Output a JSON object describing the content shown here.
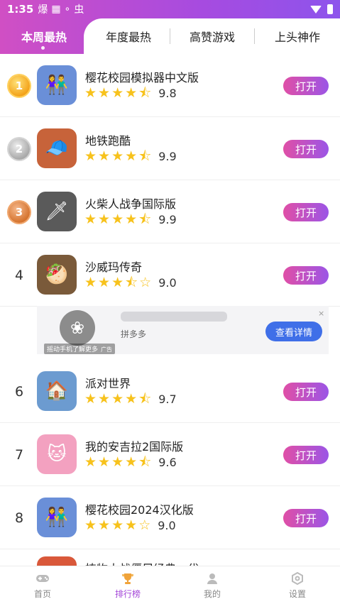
{
  "status_bar": {
    "time": "1:35",
    "icons": [
      "爆",
      "▦",
      "∘",
      "虫"
    ]
  },
  "tabs": {
    "active": "本周最热",
    "items": [
      "年度最热",
      "高赞游戏",
      "上头神作"
    ]
  },
  "apps": [
    {
      "rank": "1",
      "medal": "gold",
      "name": "樱花校园模拟器中文版",
      "rating": 4.5,
      "score": "9.8",
      "button": "打开",
      "icon_color": "#6a8fd8",
      "icon_glyph": "👫"
    },
    {
      "rank": "2",
      "medal": "silver",
      "name": "地铁跑酷",
      "rating": 4.5,
      "score": "9.9",
      "button": "打开",
      "icon_color": "#c7633a",
      "icon_glyph": "🧢"
    },
    {
      "rank": "3",
      "medal": "bronze",
      "name": "火柴人战争国际版",
      "rating": 4.5,
      "score": "9.9",
      "button": "打开",
      "icon_color": "#5a5a5a",
      "icon_glyph": "🗡"
    },
    {
      "rank": "4",
      "medal": "",
      "name": "沙威玛传奇",
      "rating": 3.5,
      "score": "9.0",
      "button": "打开",
      "icon_color": "#7a5a3a",
      "icon_glyph": "🥙"
    },
    {
      "rank": "6",
      "medal": "",
      "name": "派对世界",
      "rating": 4.5,
      "score": "9.7",
      "button": "打开",
      "icon_color": "#6c9bd0",
      "icon_glyph": "🏠"
    },
    {
      "rank": "7",
      "medal": "",
      "name": "我的安吉拉2国际版",
      "rating": 4.5,
      "score": "9.6",
      "button": "打开",
      "icon_color": "#f3a1c0",
      "icon_glyph": "🐱"
    },
    {
      "rank": "8",
      "medal": "",
      "name": "樱花校园2024汉化版",
      "rating": 4,
      "score": "9.0",
      "button": "打开",
      "icon_color": "#6a8fd8",
      "icon_glyph": "👫"
    }
  ],
  "ad": {
    "source": "拼多多",
    "button": "查看详情",
    "hint": "摇动手机了解更多",
    "tag": "广告",
    "close": "×"
  },
  "partial_row_name": "植物大战僵尸经典一代",
  "bottom_nav": [
    {
      "label": "首页",
      "icon": "gamepad-icon",
      "active": false
    },
    {
      "label": "排行榜",
      "icon": "trophy-icon",
      "active": true
    },
    {
      "label": "我的",
      "icon": "user-icon",
      "active": false
    },
    {
      "label": "设置",
      "icon": "settings-icon",
      "active": false
    }
  ],
  "colors": {
    "accent_start": "#e04fa6",
    "accent_end": "#9b55e6",
    "star": "#f7c21c",
    "nav_active": "#a447d8"
  }
}
